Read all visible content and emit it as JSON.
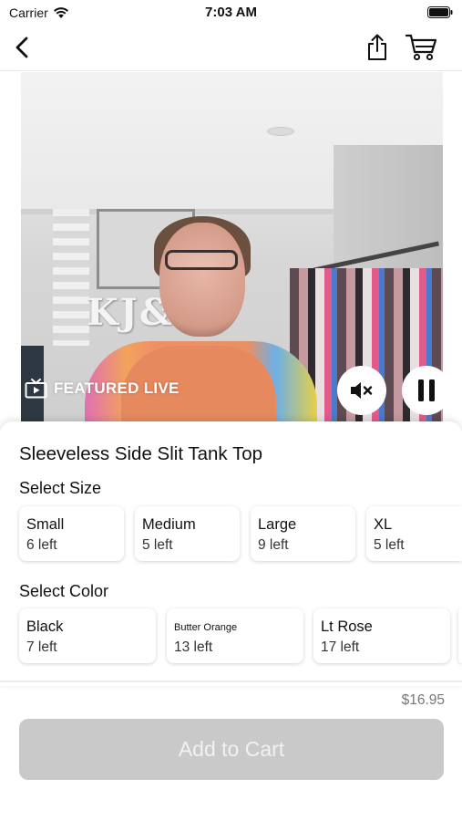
{
  "status_bar": {
    "carrier": "Carrier",
    "time": "7:03 AM"
  },
  "nav": {
    "back_icon": "chevron-left-icon",
    "share_icon": "share-icon",
    "cart_icon": "cart-icon"
  },
  "video": {
    "badge_icon": "tv-icon",
    "badge_label": "FEATURED LIVE",
    "mute_icon": "speaker-muted-icon",
    "pause_icon": "pause-icon",
    "sign_text": "KJ&C"
  },
  "product": {
    "title": "Sleeveless Side Slit Tank Top",
    "size_heading": "Select Size",
    "sizes": [
      {
        "name": "Small",
        "count": "6 left"
      },
      {
        "name": "Medium",
        "count": "5 left"
      },
      {
        "name": "Large",
        "count": "9 left"
      },
      {
        "name": "XL",
        "count": "5 left"
      }
    ],
    "color_heading": "Select Color",
    "colors": [
      {
        "name": "Black",
        "count": "7 left"
      },
      {
        "name": "Butter Orange",
        "count": "13 left"
      },
      {
        "name": "Lt Rose",
        "count": "17 left"
      }
    ]
  },
  "checkout": {
    "price": "$16.95",
    "add_to_cart_label": "Add to Cart"
  },
  "colors": {
    "button_disabled": "#c9c9c9",
    "button_text": "#f1f1f1",
    "price_text": "#777777"
  }
}
